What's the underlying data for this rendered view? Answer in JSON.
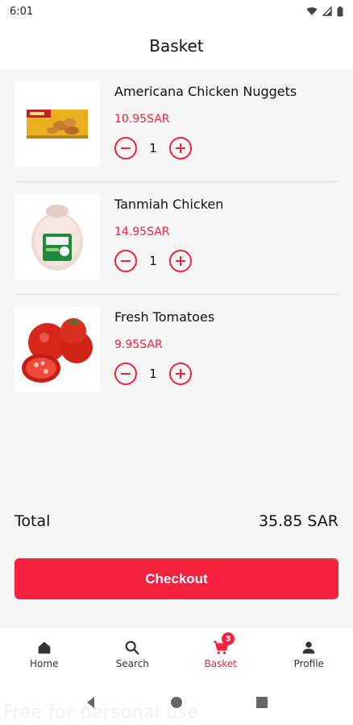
{
  "status_bar": {
    "time": "6:01"
  },
  "header": {
    "title": "Basket"
  },
  "basket": {
    "items": [
      {
        "name": "Americana Chicken Nuggets",
        "price": "10.95SAR",
        "qty": "1",
        "image_icon": "nuggets-box-image"
      },
      {
        "name": "Tanmiah Chicken",
        "price": "14.95SAR",
        "qty": "1",
        "image_icon": "whole-chicken-image"
      },
      {
        "name": "Fresh Tomatoes",
        "price": "9.95SAR",
        "qty": "1",
        "image_icon": "tomatoes-image"
      }
    ]
  },
  "total": {
    "label": "Total",
    "value": "35.85 SAR"
  },
  "checkout": {
    "label": "Checkout"
  },
  "nav": {
    "items": [
      {
        "label": "Home",
        "icon": "home-icon"
      },
      {
        "label": "Search",
        "icon": "search-icon"
      },
      {
        "label": "Basket",
        "icon": "cart-icon",
        "badge": "3",
        "active": true
      },
      {
        "label": "Profile",
        "icon": "person-icon"
      }
    ]
  },
  "watermark": "Free for personal use",
  "colors": {
    "accent": "#f5213f",
    "background": "#f6f6f6",
    "surface": "#ffffff"
  }
}
